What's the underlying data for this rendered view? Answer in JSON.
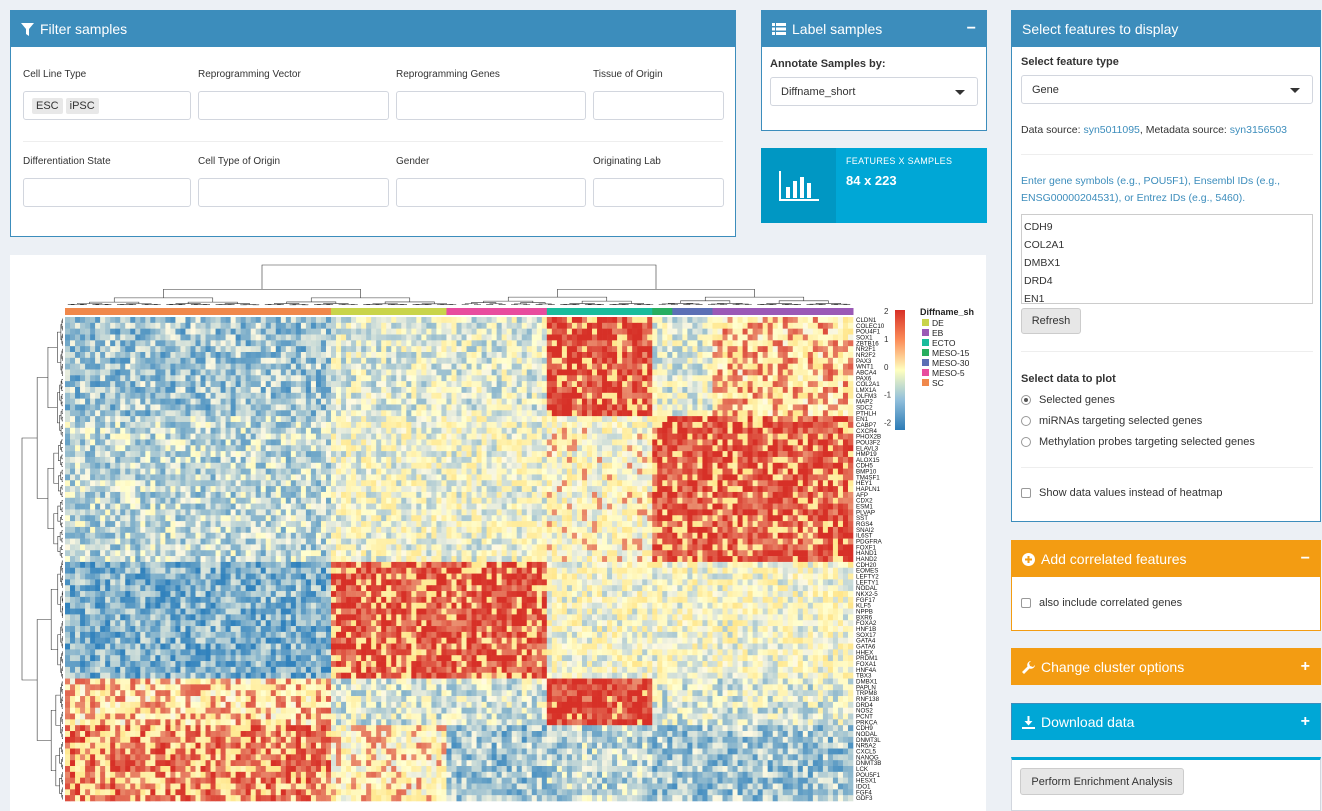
{
  "filter": {
    "title": "Filter samples",
    "fields": {
      "cell_line_type": {
        "label": "Cell Line Type",
        "chips": [
          "ESC",
          "iPSC"
        ]
      },
      "reprogramming_vector": {
        "label": "Reprogramming Vector"
      },
      "reprogramming_genes": {
        "label": "Reprogramming Genes"
      },
      "tissue_of_origin": {
        "label": "Tissue of Origin"
      },
      "differentiation_state": {
        "label": "Differentiation State"
      },
      "cell_type_of_origin": {
        "label": "Cell Type of Origin"
      },
      "gender": {
        "label": "Gender"
      },
      "originating_lab": {
        "label": "Originating Lab"
      }
    }
  },
  "label": {
    "title": "Label samples",
    "annotate_label": "Annotate Samples by:",
    "annotate_value": "Diffname_short",
    "collapse": "−"
  },
  "stats": {
    "label": "FEATURES X SAMPLES",
    "value": "84 x 223"
  },
  "features": {
    "title": "Select features to display",
    "type_label": "Select feature type",
    "type_value": "Gene",
    "source_prefix": "Data source:",
    "source_link": "syn5011095",
    "meta_prefix": ", Metadata source:",
    "meta_link": "syn3156503",
    "instructions": "Enter gene symbols (e.g., POU5F1), Ensembl IDs (e.g., ENSG00000204531), or Entrez IDs (e.g., 5460).",
    "genes": [
      "CDH9",
      "COL2A1",
      "DMBX1",
      "DRD4",
      "EN1"
    ],
    "refresh": "Refresh",
    "plot_label": "Select data to plot",
    "plot_options": [
      "Selected genes",
      "miRNAs targeting selected genes",
      "Methylation probes targeting selected genes"
    ],
    "show_values": "Show data values instead of heatmap"
  },
  "correlated": {
    "title": "Add correlated features",
    "tool": "−",
    "option": "also include correlated genes"
  },
  "cluster": {
    "title": "Change cluster options",
    "tool": "+"
  },
  "download": {
    "title": "Download data",
    "tool": "+"
  },
  "enrichment": {
    "button": "Perform Enrichment Analysis"
  },
  "heatmap": {
    "legend_title": "Diffname_sh",
    "groups": [
      {
        "name": "DE",
        "color": "#c9d44a"
      },
      {
        "name": "EB",
        "color": "#9b59b6"
      },
      {
        "name": "ECTO",
        "color": "#1abc9c"
      },
      {
        "name": "MESO-15",
        "color": "#27ae60"
      },
      {
        "name": "MESO-30",
        "color": "#5b6fb5"
      },
      {
        "name": "MESO-5",
        "color": "#e84c9e"
      },
      {
        "name": "SC",
        "color": "#f0884b"
      }
    ],
    "scale_ticks": [
      "2",
      "1",
      "0",
      "-1",
      "-2"
    ],
    "genes": [
      "CLDN1",
      "COLEC10",
      "POU4F1",
      "SOX1",
      "ZBTB16",
      "NR2F1",
      "NR2F2",
      "PAX3",
      "WNT1",
      "ABCA4",
      "PAX6",
      "COL2A1",
      "LMX1A",
      "OLFM3",
      "MAP2",
      "SDC2",
      "PTHLH",
      "EN1",
      "CABP7",
      "CXCR4",
      "PHOX2B",
      "POU3F2",
      "ELAVL3",
      "HMP19",
      "ALOX15",
      "CDH5",
      "BMP10",
      "TM4SF1",
      "HEY1",
      "HAPLN1",
      "AFP",
      "CDX2",
      "ESM1",
      "PLVAP",
      "SST",
      "RGS4",
      "SNAI2",
      "IL6ST",
      "PDGFRA",
      "FOXF1",
      "HAND1",
      "HAND2",
      "CDH20",
      "EOMES",
      "LEFTY2",
      "LEFTY1",
      "NODAL",
      "NKX2-5",
      "FGF17",
      "KLF5",
      "NPPB",
      "BXR6",
      "FOXA2",
      "HNF1B",
      "SOX17",
      "GATA4",
      "GATA6",
      "HHEX",
      "PRDM1",
      "FOXA1",
      "HNF4A",
      "TBX3",
      "DMBX1",
      "PAPLN",
      "TRPM8",
      "RNF138",
      "DRD4",
      "NOS2",
      "PCNT",
      "PRKCA",
      "CDH9",
      "NODAL",
      "DNMT3L",
      "NR5A2",
      "CXCL5",
      "NANOG",
      "DNMT3B",
      "LCK",
      "POU5F1",
      "HESX1",
      "IDO1",
      "FGF4",
      "GDF3"
    ]
  }
}
